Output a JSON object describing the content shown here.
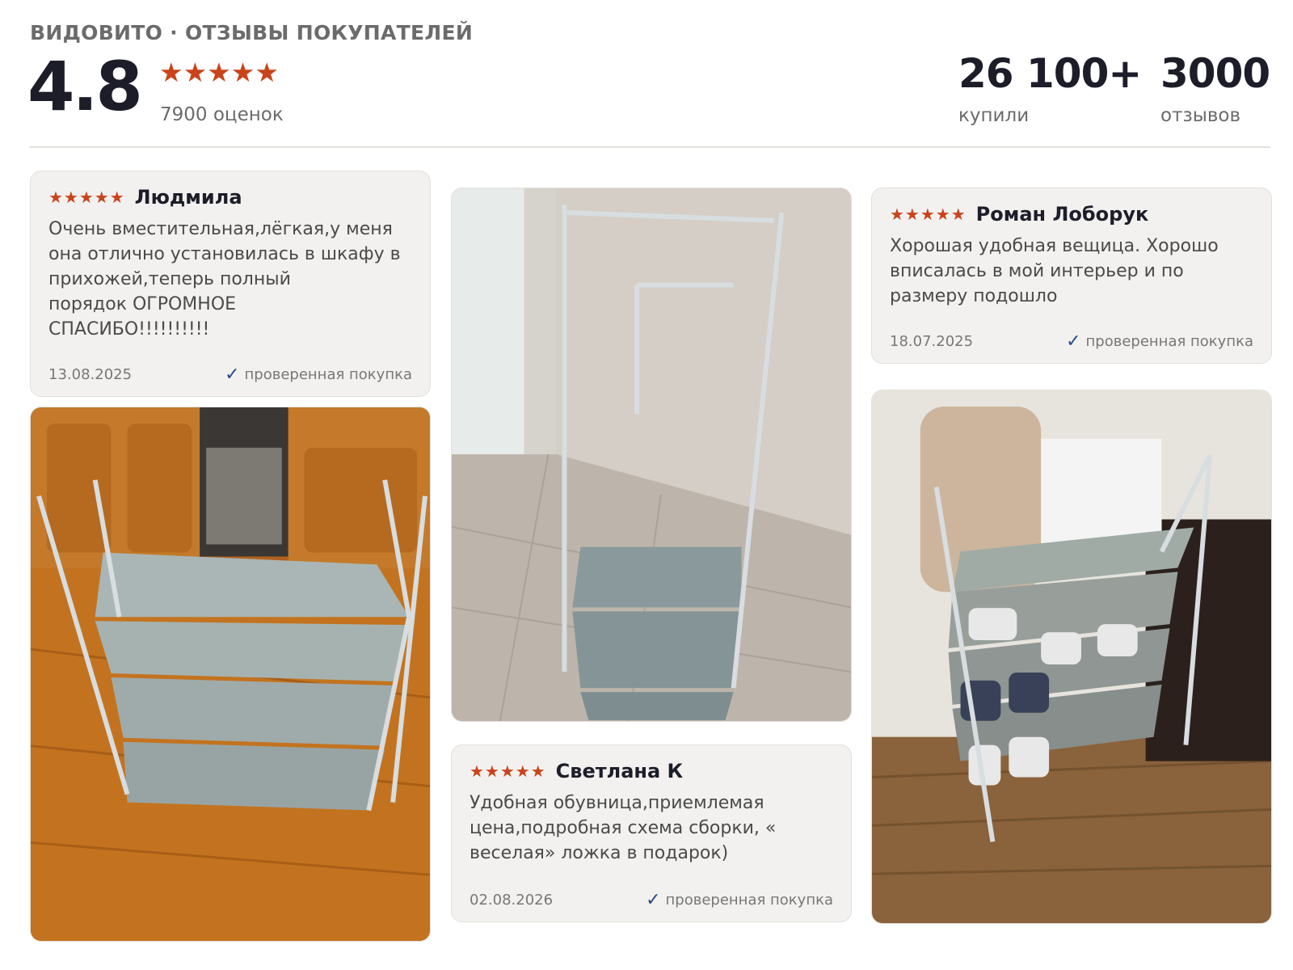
{
  "header": {
    "brand": "ВИДОВИТО · ОТЗЫВЫ ПОКУПАТЕЛЕЙ",
    "rating": "4.8",
    "stars": "★★★★★",
    "ratings_count": "7900 оценок",
    "stats": [
      {
        "value": "26 100+",
        "label": "купили"
      },
      {
        "value": "3000",
        "label": "отзывов"
      }
    ]
  },
  "reviews": [
    {
      "stars": "★★★★★",
      "author": "Людмила",
      "text": "Очень вместительная,лёгкая,у меня\nона отлично установилась в шкафу в\nприхожей,теперь полный\nпорядок            ОГРОМНОЕ\nСПАСИБО!!!!!!!!!!",
      "date": "13.08.2025",
      "verified": "проверенная покупка"
    },
    {
      "stars": "★★★★★",
      "author": "Роман Лоборук",
      "text": "Хорошая удобная вещица. Хорошо\nвписалась в мой интерьер и по\nразмеру подошло",
      "date": "18.07.2025",
      "verified": "проверенная покупка"
    },
    {
      "stars": "★★★★★",
      "author": "Светлана К",
      "text": "Удобная обувница,приемлемая\nцена,подробная схема сборки, «\nвеселая» ложка в подарок)",
      "date": "02.08.2026",
      "verified": "проверенная покупка"
    }
  ],
  "colors": {
    "accent_star": "#c9431b",
    "card_bg": "#f2f1ef",
    "check": "#274b8a",
    "text_dark": "#1d1d2a"
  }
}
